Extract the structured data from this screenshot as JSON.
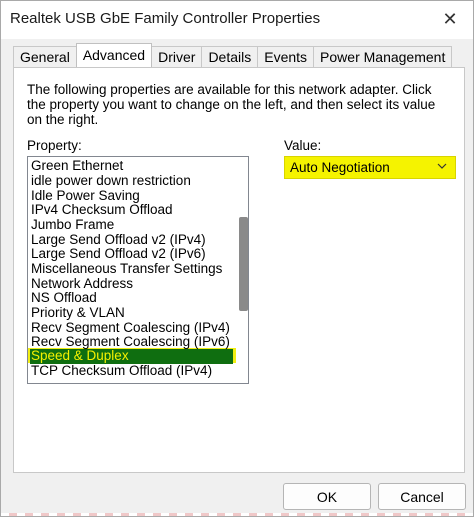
{
  "window": {
    "title": "Realtek USB GbE Family Controller Properties",
    "close_glyph": "✕"
  },
  "tabs": [
    {
      "label": "General",
      "active": false
    },
    {
      "label": "Advanced",
      "active": true
    },
    {
      "label": "Driver",
      "active": false
    },
    {
      "label": "Details",
      "active": false
    },
    {
      "label": "Events",
      "active": false
    },
    {
      "label": "Power Management",
      "active": false
    }
  ],
  "advanced": {
    "description": "The following properties are available for this network adapter. Click the property you want to change on the left, and then select its value on the right.",
    "property_label": "Property:",
    "value_label": "Value:",
    "properties": [
      "Green Ethernet",
      "idle power down restriction",
      "Idle Power Saving",
      "IPv4 Checksum Offload",
      "Jumbo Frame",
      "Large Send Offload v2 (IPv4)",
      "Large Send Offload v2 (IPv6)",
      "Miscellaneous Transfer Settings",
      "Network Address",
      "NS Offload",
      "Priority & VLAN",
      "Recv Segment Coalescing (IPv4)",
      "Recv Segment Coalescing (IPv6)",
      "Speed & Duplex",
      "TCP Checksum Offload (IPv4)"
    ],
    "selected_property": "Speed & Duplex",
    "selected_value": "Auto Negotiation",
    "dropdown_icon": "chevron-down-icon",
    "highlight_color": "#f1ee13",
    "selection_color": "#0f6e10"
  },
  "buttons": {
    "ok_label": "OK",
    "cancel_label": "Cancel"
  }
}
